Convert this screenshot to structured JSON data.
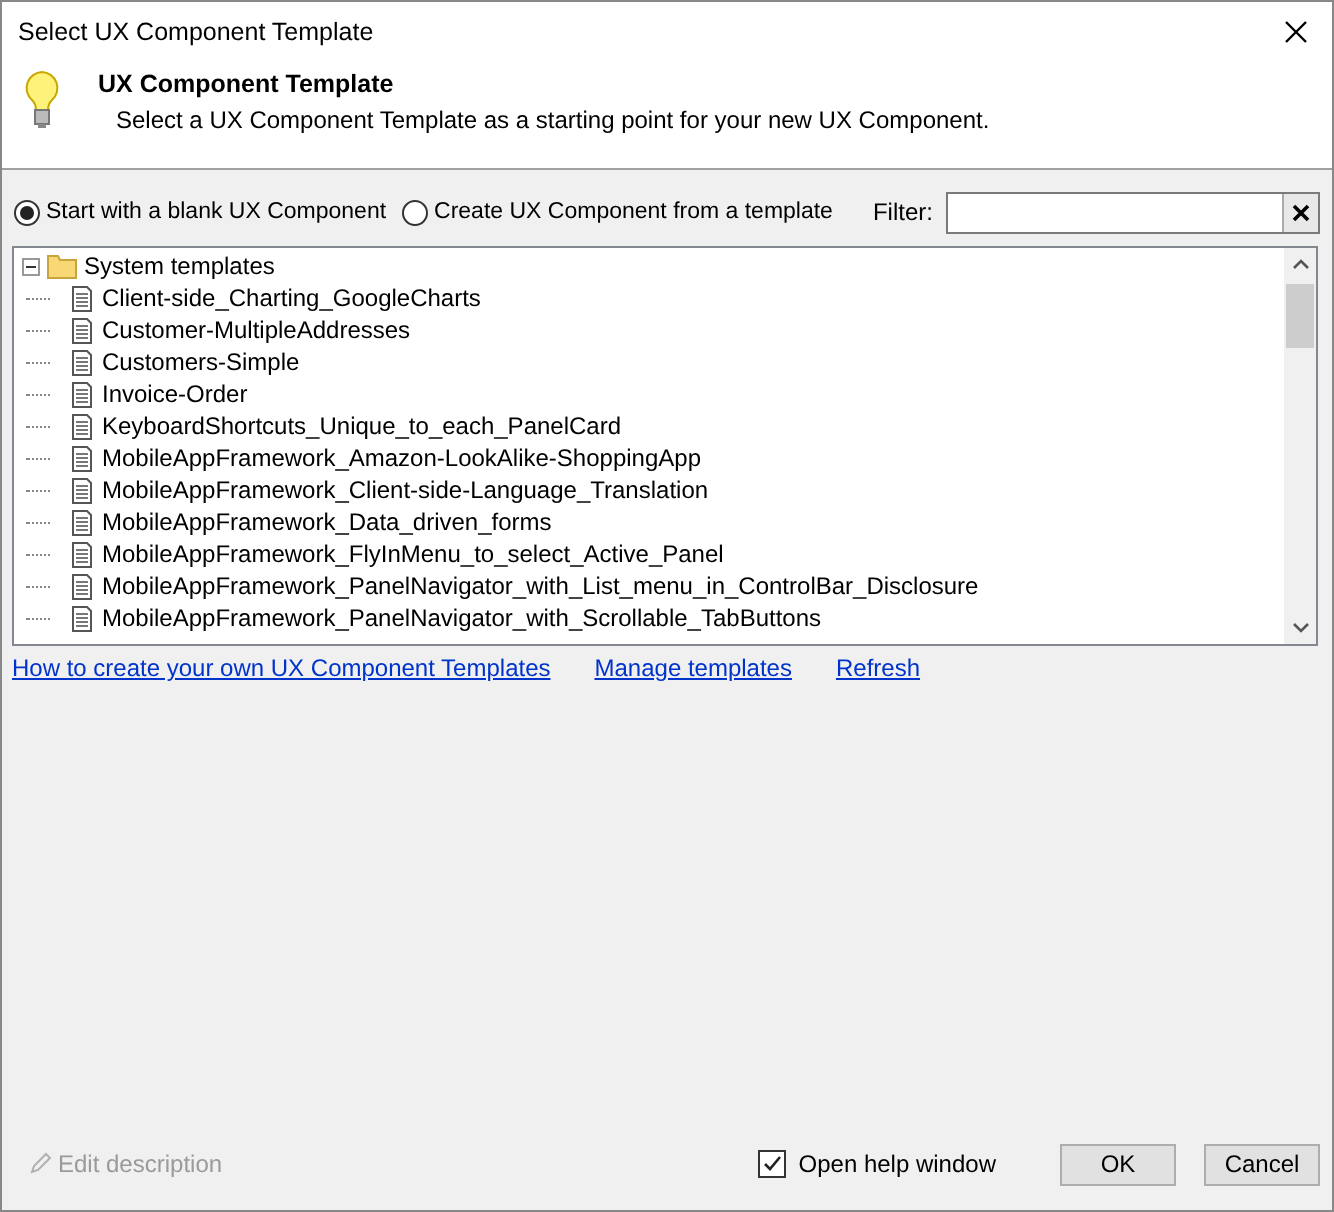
{
  "window": {
    "title": "Select UX Component Template"
  },
  "header": {
    "title": "UX Component Template",
    "subtitle": "Select a UX Component Template as a starting point for your new UX Component."
  },
  "options": [
    {
      "label": "Start with a blank UX Component",
      "selected": true
    },
    {
      "label": "Create UX Component from a template",
      "selected": false
    }
  ],
  "filter": {
    "label": "Filter:"
  },
  "tree": [
    {
      "label": "System templates",
      "expanded": true,
      "children": [
        {
          "label": "Client-side_Charting_GoogleCharts"
        },
        {
          "label": "Customer-MultipleAddresses"
        },
        {
          "label": "Customers-Simple"
        },
        {
          "label": "Invoice-Order"
        },
        {
          "label": "KeyboardShortcuts_Unique_to_each_PanelCard"
        },
        {
          "label": "MobileAppFramework_Amazon-LookAlike-ShoppingApp"
        },
        {
          "label": "MobileAppFramework_Client-side-Language_Translation"
        },
        {
          "label": "MobileAppFramework_Data_driven_forms"
        },
        {
          "label": "MobileAppFramework_FlyInMenu_to_select_Active_Panel"
        },
        {
          "label": "MobileAppFramework_PanelNavigator_with_List_menu_in_ControlBar_Disclosure"
        },
        {
          "label": "MobileAppFramework_PanelNavigator_with_Scrollable_TabButtons"
        }
      ]
    }
  ],
  "links": [
    "How to create your own UX Component Templates",
    "Manage templates",
    "Refresh"
  ],
  "edit_description": {
    "label": "Edit description",
    "disabled": true
  },
  "open_help": {
    "label": "Open help window",
    "checked": true
  },
  "buttons": [
    "OK",
    "Cancel"
  ]
}
